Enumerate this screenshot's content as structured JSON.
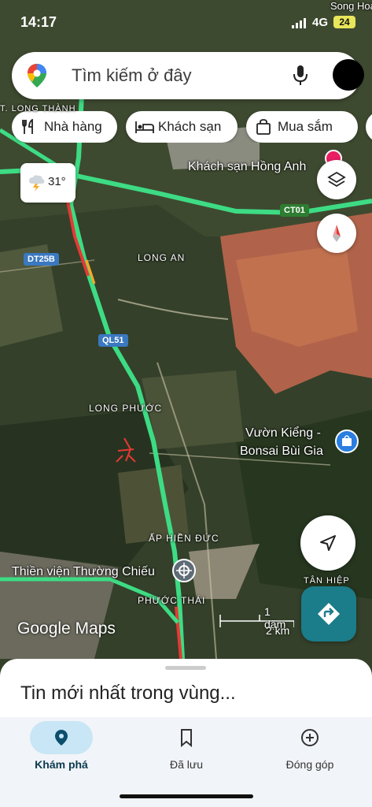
{
  "status_bar": {
    "time": "14:17",
    "network": "4G",
    "battery": "24"
  },
  "search": {
    "placeholder": "Tìm kiếm ở đây",
    "icons": [
      "maps-pin-icon",
      "mic-icon",
      "avatar"
    ]
  },
  "chips": [
    {
      "label": "Nhà hàng",
      "icon": "restaurant-icon"
    },
    {
      "label": "Khách sạn",
      "icon": "hotel-icon"
    },
    {
      "label": "Mua sắm",
      "icon": "shopping-icon"
    }
  ],
  "weather": {
    "temp": "31°",
    "icon": "thunderstorm-icon"
  },
  "map": {
    "place_labels": {
      "long_thanh": "T. LONG THÀNH",
      "long_an": "LONG AN",
      "long_phuoc": "LONG PHƯỚC",
      "ap_hien_duc": "ẤP HIỀN ĐỨC",
      "phuoc_thai": "PHƯỚC THÁI",
      "tan_hiep": "TÂN HIỆP",
      "song_hoa": "Song Hoa"
    },
    "poi_labels": {
      "hotel": "Khách sạn Hồng Anh",
      "garden_line1": "Vườn Kiểng -",
      "garden_line2": "Bonsai Bùi Gia",
      "monastery": "Thiền viện Thường Chiếu"
    },
    "road_shields": {
      "ct01": "CT01",
      "dt25b": "DT25B",
      "ql51": "QL51"
    },
    "colors": {
      "highway": "#3ddc84",
      "congestion": "#e53935",
      "slow": "#f9a825",
      "shield_green": "#2e7d32",
      "shield_blue": "#3a78c0",
      "pin_red": "#e53935"
    }
  },
  "attribution": "Google Maps",
  "scale": {
    "top": "1 dặm",
    "bottom": "2 km"
  },
  "sheet": {
    "title": "Tin mới nhất trong vùng..."
  },
  "bottom_nav": [
    {
      "label": "Khám phá",
      "icon": "explore-pin-icon",
      "active": true
    },
    {
      "label": "Đã lưu",
      "icon": "bookmark-icon",
      "active": false
    },
    {
      "label": "Đóng góp",
      "icon": "add-circle-icon",
      "active": false
    }
  ]
}
